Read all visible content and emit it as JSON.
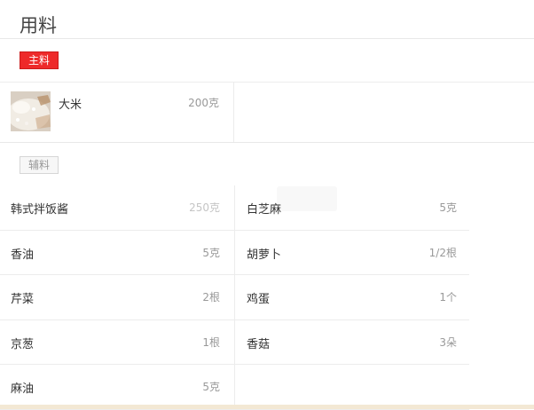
{
  "title": "用料",
  "main": {
    "tag": "主料",
    "items": [
      {
        "name": "大米",
        "amount": "200克",
        "image": "rice-photo"
      }
    ]
  },
  "sub": {
    "tag": "辅料",
    "rows": [
      {
        "left": {
          "name": "韩式拌饭酱",
          "amount": "250克"
        },
        "right": {
          "name": "白芝麻",
          "amount": "5克"
        }
      },
      {
        "left": {
          "name": "香油",
          "amount": "5克"
        },
        "right": {
          "name": "胡萝卜",
          "amount": "1/2根"
        }
      },
      {
        "left": {
          "name": "芹菜",
          "amount": "2根"
        },
        "right": {
          "name": "鸡蛋",
          "amount": "1个"
        }
      },
      {
        "left": {
          "name": "京葱",
          "amount": "1根"
        },
        "right": {
          "name": "香菇",
          "amount": "3朵"
        }
      },
      {
        "left": {
          "name": "麻油",
          "amount": "5克"
        },
        "right": {
          "name": "",
          "amount": ""
        }
      }
    ]
  },
  "colors": {
    "main_tag_bg": "#ee2a2a",
    "sub_tag_bg": "#f7f7f7",
    "bottom_strip": "#f3e8d4"
  }
}
